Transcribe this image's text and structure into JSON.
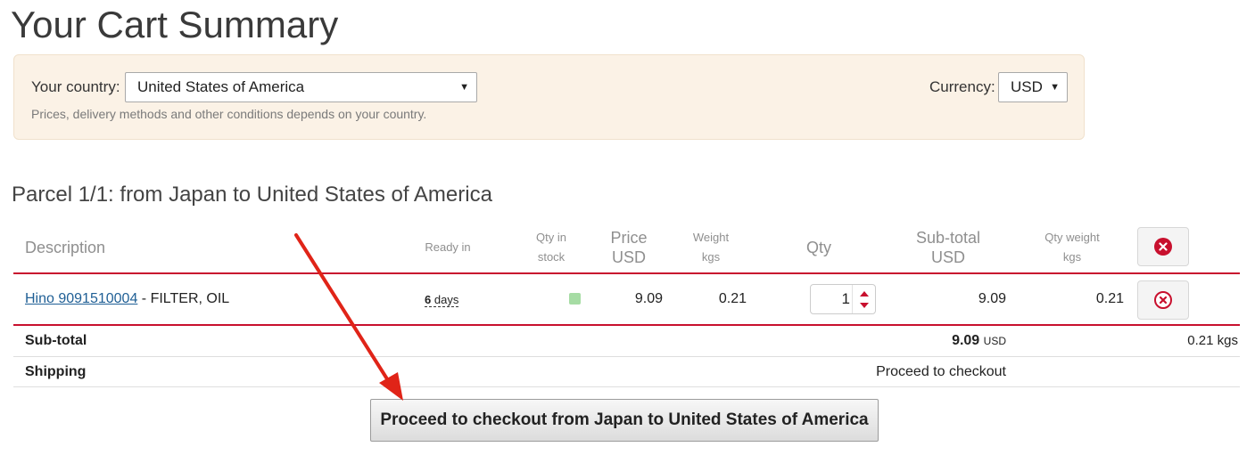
{
  "page": {
    "title": "Your Cart Summary"
  },
  "country_panel": {
    "country_label": "Your country:",
    "country_value": "United States of America",
    "currency_label": "Currency:",
    "currency_value": "USD",
    "note": "Prices, delivery methods and other conditions depends on your country."
  },
  "parcel": {
    "title": "Parcel 1/1: from Japan to United States of America",
    "headers": {
      "description": "Description",
      "ready_in": "Ready in",
      "qty_in_stock_1": "Qty in",
      "qty_in_stock_2": "stock",
      "price_1": "Price",
      "price_2": "USD",
      "weight_1": "Weight",
      "weight_2": "kgs",
      "qty": "Qty",
      "subtotal_1": "Sub-total",
      "subtotal_2": "USD",
      "qty_weight_1": "Qty weight",
      "qty_weight_2": "kgs"
    },
    "item": {
      "part_link": "Hino 9091510004",
      "part_desc": " - FILTER, OIL",
      "ready_num": "6",
      "ready_unit": "days",
      "price": "9.09",
      "weight": "0.21",
      "qty": "1",
      "subtotal": "9.09",
      "qty_weight": "0.21"
    },
    "summary": {
      "subtotal_label": "Sub-total",
      "subtotal_value": "9.09",
      "subtotal_currency": "USD",
      "subtotal_weight": "0.21 kgs",
      "shipping_label": "Shipping",
      "shipping_value": "Proceed to checkout"
    },
    "checkout_button": "Proceed to checkout from Japan to United States of America"
  },
  "icons": {
    "delete": "delete-circle-icon",
    "caret": "caret-down-icon",
    "stepper_up": "arrow-up-icon",
    "stepper_down": "arrow-down-icon",
    "annotation": "red-arrow-annotation"
  },
  "colors": {
    "accent": "#c8102e",
    "panel_bg": "#fbf2e6",
    "link": "#1f5f95",
    "stock": "#a6dca4"
  }
}
